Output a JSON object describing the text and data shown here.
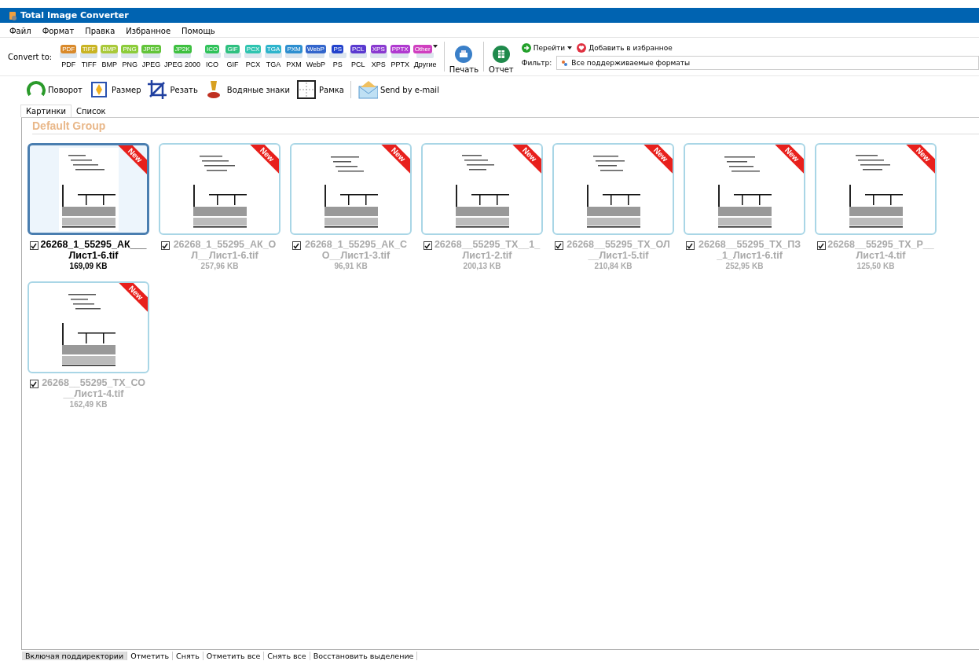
{
  "window": {
    "title": "Total Image Converter"
  },
  "menu": [
    "Файл",
    "Формат",
    "Правка",
    "Избранное",
    "Помощь"
  ],
  "convert_toolbar": {
    "label": "Convert to:",
    "formats": [
      {
        "badge": "PDF",
        "label": "PDF",
        "color": "#d98a2b"
      },
      {
        "badge": "TIFF",
        "label": "TIFF",
        "color": "#c9b423"
      },
      {
        "badge": "BMP",
        "label": "BMP",
        "color": "#a9c93a"
      },
      {
        "badge": "PNG",
        "label": "PNG",
        "color": "#8ccc3a"
      },
      {
        "badge": "JPEG",
        "label": "JPEG",
        "color": "#62c43a"
      },
      {
        "badge": "JP2K",
        "label": "JPEG 2000",
        "color": "#3ec040"
      },
      {
        "badge": "ICO",
        "label": "ICO",
        "color": "#2fc25a"
      },
      {
        "badge": "GIF",
        "label": "GIF",
        "color": "#2ec080"
      },
      {
        "badge": "PCX",
        "label": "PCX",
        "color": "#2fc4b0"
      },
      {
        "badge": "TGA",
        "label": "TGA",
        "color": "#2eb4cc"
      },
      {
        "badge": "PXM",
        "label": "PXM",
        "color": "#2e8fd0"
      },
      {
        "badge": "WebP",
        "label": "WebP",
        "color": "#3366cc"
      },
      {
        "badge": "PS",
        "label": "PS",
        "color": "#2242cc"
      },
      {
        "badge": "PCL",
        "label": "PCL",
        "color": "#5a3ad0"
      },
      {
        "badge": "XPS",
        "label": "XPS",
        "color": "#8a3ad0"
      },
      {
        "badge": "PPTX",
        "label": "PPTX",
        "color": "#b03ad0"
      },
      {
        "badge": "Other",
        "label": "Другие",
        "color": "#d040c0"
      }
    ],
    "print": "Печать",
    "report": "Отчет",
    "goto": "Перейти",
    "favorites": "Добавить в избранное",
    "filter_label": "Фильтр:",
    "filter_value": "Все поддерживаемые форматы"
  },
  "tools": [
    {
      "kind": "rotate",
      "label": "Поворот"
    },
    {
      "kind": "resize",
      "label": "Размер"
    },
    {
      "kind": "crop",
      "label": "Резать"
    },
    {
      "kind": "watermark",
      "label": "Водяные знаки"
    },
    {
      "kind": "frame",
      "label": "Рамка"
    },
    {
      "kind": "email",
      "label": "Send by e-mail"
    }
  ],
  "tabs": [
    {
      "label": "Картинки",
      "selected": true
    },
    {
      "label": "Список",
      "selected": false
    }
  ],
  "group": {
    "title": "Default Group"
  },
  "files": [
    {
      "name": "26268_1_55295_АК___Лист1-6.tif",
      "size": "169,09 KB",
      "selected": true,
      "checked": true,
      "badge": "New"
    },
    {
      "name": "26268_1_55295_АК_ОЛ__Лист1-6.tif",
      "size": "257,96 KB",
      "selected": false,
      "checked": true,
      "badge": "New"
    },
    {
      "name": "26268_1_55295_АК_СО__Лист1-3.tif",
      "size": "96,91 KB",
      "selected": false,
      "checked": true,
      "badge": "New"
    },
    {
      "name": "26268__55295_ТХ__1_Лист1-2.tif",
      "size": "200,13 KB",
      "selected": false,
      "checked": true,
      "badge": "New"
    },
    {
      "name": "26268__55295_ТХ_ОЛ__Лист1-5.tif",
      "size": "210,84 KB",
      "selected": false,
      "checked": true,
      "badge": "New"
    },
    {
      "name": "26268__55295_ТХ_ПЗ_1_Лист1-6.tif",
      "size": "252,95 KB",
      "selected": false,
      "checked": true,
      "badge": "New"
    },
    {
      "name": "26268__55295_ТХ_Р__Лист1-4.tif",
      "size": "125,50 KB",
      "selected": false,
      "checked": true,
      "badge": "New"
    },
    {
      "name": "26268__55295_ТХ_СО__Лист1-4.tif",
      "size": "162,49 KB",
      "selected": false,
      "checked": true,
      "badge": "New"
    }
  ],
  "status_bar": [
    {
      "label": "Включая поддиректории",
      "selected": true
    },
    {
      "label": "Отметить",
      "selected": false
    },
    {
      "label": "Снять",
      "selected": false
    },
    {
      "label": "Отметить все",
      "selected": false
    },
    {
      "label": "Снять все",
      "selected": false
    },
    {
      "label": "Восстановить выделение",
      "selected": false
    }
  ]
}
